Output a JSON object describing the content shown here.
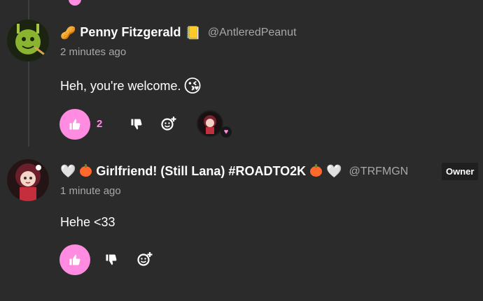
{
  "comments": [
    {
      "user_emoji": "🥜",
      "name": "Penny Fitzgerald",
      "name_badge": "📒",
      "handle": "@AntleredPeanut",
      "time": "2 minutes ago",
      "text": "Heh, you're welcome.",
      "text_emoji": "😘",
      "likes": "2",
      "icons": [
        "thumbs-up-icon",
        "thumbs-down-icon",
        "add-reaction-icon"
      ],
      "reaction_heart": "♥"
    },
    {
      "heart_left": "🤍",
      "name": "Girlfriend! (Still Lana) #ROADTO2K",
      "heart_right": "🤍",
      "handle": "@TRFMGN",
      "owner_label": "Owner",
      "time": "1 minute ago",
      "text": "Hehe <33",
      "icons": [
        "thumbs-up-icon",
        "thumbs-down-icon",
        "add-reaction-icon"
      ]
    }
  ],
  "colors": {
    "accent": "#ff8ce0",
    "background": "#2b2b2b",
    "muted": "#a8a8a8"
  }
}
